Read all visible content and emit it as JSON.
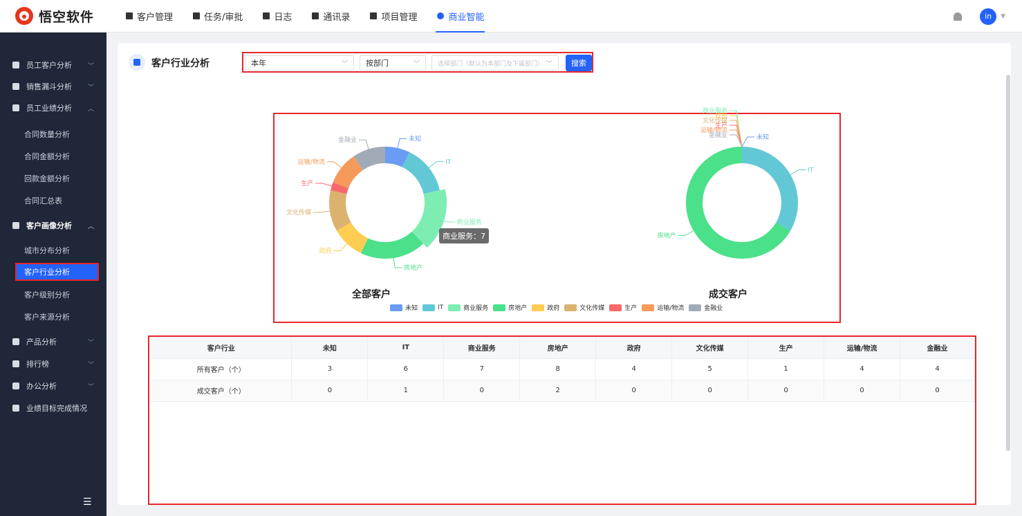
{
  "app": {
    "name": "悟空软件"
  },
  "topnav": [
    {
      "label": "客户管理",
      "active": false
    },
    {
      "label": "任务/审批",
      "active": false
    },
    {
      "label": "日志",
      "active": false
    },
    {
      "label": "通讯录",
      "active": false
    },
    {
      "label": "项目管理",
      "active": false
    },
    {
      "label": "商业智能",
      "active": true
    }
  ],
  "user": {
    "avatar": "in"
  },
  "sidebar": {
    "groups": [
      {
        "label": "员工客户分析"
      },
      {
        "label": "销售漏斗分析"
      },
      {
        "label": "员工业绩分析"
      },
      {
        "label": "客户画像分析"
      },
      {
        "label": "产品分析"
      },
      {
        "label": "排行榜"
      },
      {
        "label": "办公分析"
      },
      {
        "label": "业绩目标完成情况"
      }
    ],
    "subs_perf": [
      "合同数量分析",
      "合同金额分析",
      "回款金额分析",
      "合同汇总表"
    ],
    "subs_profile": [
      "城市分布分析",
      "客户行业分析",
      "客户级别分析",
      "客户来源分析"
    ]
  },
  "page": {
    "title": "客户行业分析"
  },
  "filters": {
    "period": "本年",
    "scope": "按部门",
    "dept_placeholder": "选择部门（默认为本部门及下属部门）",
    "search_label": "搜索"
  },
  "tooltip": "商业服务：7",
  "chart_data": [
    {
      "type": "pie",
      "title": "全部客户",
      "categories": [
        "未知",
        "IT",
        "商业服务",
        "房地产",
        "政府",
        "文化传媒",
        "生产",
        "运输/物流",
        "金融业"
      ],
      "values": [
        3,
        6,
        7,
        8,
        4,
        5,
        1,
        4,
        4
      ],
      "colors": [
        "#6b9cf5",
        "#62c8d6",
        "#7eedb1",
        "#4be08a",
        "#fecd51",
        "#dcb26f",
        "#f8696b",
        "#f59a5b",
        "#a1abb8"
      ],
      "highlighted": "商业服务"
    },
    {
      "type": "pie",
      "title": "成交客户",
      "categories": [
        "未知",
        "IT",
        "商业服务",
        "房地产",
        "政府",
        "文化传媒",
        "生产",
        "运输/物流",
        "金融业"
      ],
      "values": [
        0,
        1,
        0,
        2,
        0,
        0,
        0,
        0,
        0
      ],
      "colors": [
        "#6b9cf5",
        "#62c8d6",
        "#7eedb1",
        "#4be08a",
        "#fecd51",
        "#dcb26f",
        "#f8696b",
        "#f59a5b",
        "#a1abb8"
      ]
    }
  ],
  "table": {
    "headers": [
      "客户行业",
      "未知",
      "IT",
      "商业服务",
      "房地产",
      "政府",
      "文化传媒",
      "生产",
      "运输/物流",
      "金融业"
    ],
    "rows": [
      [
        "所有客户（个）",
        "3",
        "6",
        "7",
        "8",
        "4",
        "5",
        "1",
        "4",
        "4"
      ],
      [
        "成交客户（个）",
        "0",
        "1",
        "0",
        "2",
        "0",
        "0",
        "0",
        "0",
        "0"
      ]
    ]
  }
}
